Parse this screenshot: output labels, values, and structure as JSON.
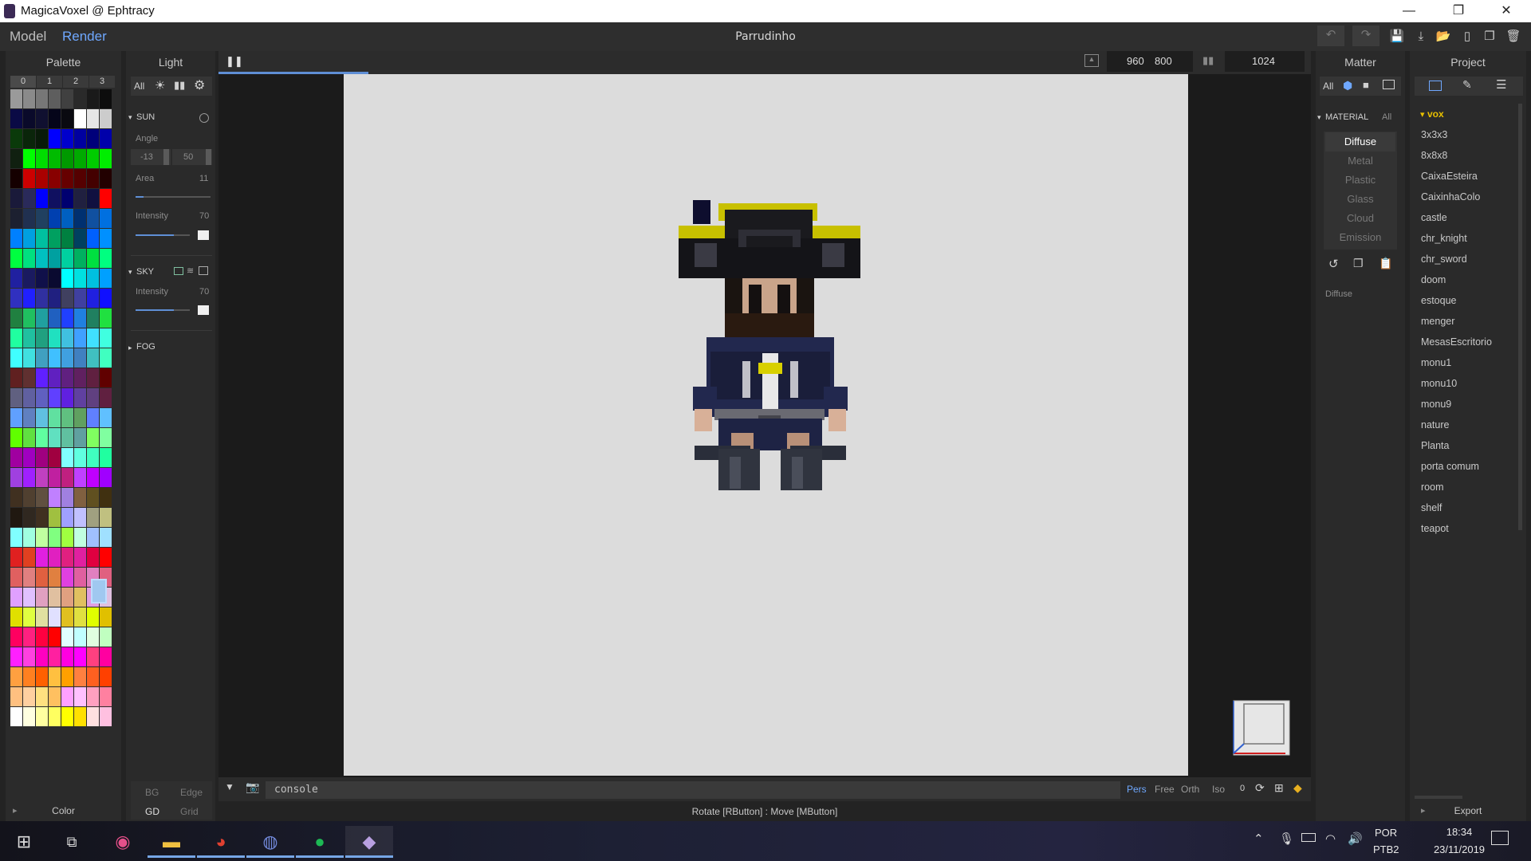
{
  "window": {
    "title": "MagicaVoxel @ Ephtracy",
    "minimize": "—",
    "restore": "❐",
    "close": "✕"
  },
  "appbar": {
    "modes": [
      "Model",
      "Render"
    ],
    "active_mode": "Render",
    "document_name": "Parrudinho"
  },
  "palette": {
    "header": "Palette",
    "tabs": [
      "0",
      "1",
      "2",
      "3"
    ],
    "footer_label": "Color",
    "bg_label": "BG",
    "edge_label": "Edge",
    "gd_label": "GD",
    "grid_label": "Grid",
    "colors": [
      "#9a9a9a",
      "#8a8a8a",
      "#777777",
      "#5e5e5e",
      "#404040",
      "#2a2a2a",
      "#1a1a1a",
      "#0d0d0d",
      "#0a0a45",
      "#0a0a2a",
      "#101030",
      "#05051a",
      "#0a0a10",
      "#ffffff",
      "#e6e6e6",
      "#cccccc",
      "#0a3a0a",
      "#0a250a",
      "#081a08",
      "#0000ff",
      "#0000cc",
      "#0000a0",
      "#00007a",
      "#0000aa",
      "#102010",
      "#00ff00",
      "#00dd00",
      "#00bb00",
      "#009900",
      "#00aa00",
      "#00cc00",
      "#00ee00",
      "#150000",
      "#cc0000",
      "#aa0000",
      "#880000",
      "#660000",
      "#550000",
      "#440000",
      "#220000",
      "#1a1a3a",
      "#2a2a5a",
      "#0000ff",
      "#101060",
      "#000070",
      "#202040",
      "#101040",
      "#ff0000",
      "#1c2030",
      "#203050",
      "#204060",
      "#0040b0",
      "#0060c0",
      "#003070",
      "#1050a0",
      "#0070e0",
      "#0080ff",
      "#00a0e0",
      "#00c0a0",
      "#00a060",
      "#008040",
      "#004060",
      "#0060ff",
      "#0090ff",
      "#00ff40",
      "#00e080",
      "#00c0c0",
      "#00a0a0",
      "#00d0a0",
      "#00b060",
      "#00e040",
      "#00ff80",
      "#2020a0",
      "#1a1a60",
      "#10104a",
      "#0a0a30",
      "#00ffff",
      "#00e0e0",
      "#00c0e0",
      "#00a0ff",
      "#3030c0",
      "#2020ff",
      "#3030a0",
      "#202080",
      "#404060",
      "#4040a0",
      "#2020e0",
      "#1010ff",
      "#208040",
      "#20c060",
      "#20a0a0",
      "#2060c0",
      "#2040ff",
      "#2080e0",
      "#208060",
      "#20e040",
      "#20ffa0",
      "#20c0a0",
      "#20a080",
      "#20e0c0",
      "#40c0e0",
      "#40a0ff",
      "#40e0ff",
      "#40ffe0",
      "#40ffff",
      "#40e0e0",
      "#40a0c0",
      "#40c0ff",
      "#40a0e0",
      "#4080c0",
      "#40c0c0",
      "#40ffc0",
      "#602020",
      "#603030",
      "#6020ff",
      "#6020c0",
      "#602080",
      "#602060",
      "#602040",
      "#600000",
      "#606080",
      "#6060a0",
      "#6060c0",
      "#6040ff",
      "#6020e0",
      "#6040a0",
      "#604080",
      "#602040",
      "#60a0ff",
      "#6080c0",
      "#60c0e0",
      "#60e0a0",
      "#60c080",
      "#60a060",
      "#6080ff",
      "#60c0ff",
      "#60ff00",
      "#60e040",
      "#60ffa0",
      "#60e0c0",
      "#60c0a0",
      "#60a0a0",
      "#80ff60",
      "#80ffa0",
      "#a000a0",
      "#a000c0",
      "#a00080",
      "#a00040",
      "#80ffff",
      "#60ffe0",
      "#40ffc0",
      "#20ffa0",
      "#a040e0",
      "#a020ff",
      "#c040c0",
      "#c020a0",
      "#c02080",
      "#c040ff",
      "#c000ff",
      "#a000ff",
      "#403020",
      "#504030",
      "#605040",
      "#c080ff",
      "#a080e0",
      "#806040",
      "#605020",
      "#403010",
      "#201810",
      "#302820",
      "#403020",
      "#a0c040",
      "#a0a0ff",
      "#c0c0ff",
      "#a0a080",
      "#c0c080",
      "#80ffff",
      "#a0ffe0",
      "#c0ffa0",
      "#80ff80",
      "#a0ff40",
      "#c0ffe0",
      "#a0c0ff",
      "#a0e0ff",
      "#e02020",
      "#e04020",
      "#e020e0",
      "#e020c0",
      "#e02080",
      "#e020a0",
      "#e00040",
      "#ff0000",
      "#e06060",
      "#e08080",
      "#e06040",
      "#e08040",
      "#e040e0",
      "#e060a0",
      "#e080c0",
      "#e06080",
      "#e0a0ff",
      "#e0c0ff",
      "#e0a0c0",
      "#e0c0a0",
      "#e0a080",
      "#e0c060",
      "#e0a0e0",
      "#e0c0e0",
      "#e0e000",
      "#e0ff40",
      "#e0e0a0",
      "#e0e0ff",
      "#e0c020",
      "#e0e040",
      "#e0ff00",
      "#e0c000",
      "#ff0060",
      "#ff2080",
      "#ff0040",
      "#ff0000",
      "#e0ffff",
      "#c0ffff",
      "#e0ffe0",
      "#c0ffc0",
      "#ff20ff",
      "#ff40e0",
      "#ff00c0",
      "#ff20a0",
      "#ff00e0",
      "#ff00ff",
      "#ff4080",
      "#ff00a0",
      "#ffa040",
      "#ff8020",
      "#ff6000",
      "#ffc040",
      "#ffa000",
      "#ff8040",
      "#ff6020",
      "#ff4000",
      "#ffc080",
      "#ffd0a0",
      "#ffe080",
      "#ffc060",
      "#ffa0ff",
      "#ffc0ff",
      "#ffa0c0",
      "#ff80a0",
      "#ffffff",
      "#ffffe0",
      "#ffffa0",
      "#ffff60",
      "#ffff00",
      "#ffe000",
      "#ffe0e0",
      "#ffc0e0"
    ]
  },
  "light": {
    "header": "Light",
    "filter_all": "All",
    "sun": {
      "label": "SUN",
      "angle_label": "Angle",
      "angle_x": "-13",
      "angle_y": "50",
      "area_label": "Area",
      "area_value": "11",
      "area_level": 0.11,
      "intensity_label": "Intensity",
      "intensity_value": "70",
      "intensity_level": 0.7
    },
    "sky": {
      "label": "SKY",
      "intensity_label": "Intensity",
      "intensity_value": "70",
      "intensity_level": 0.7
    },
    "fog": {
      "label": "FOG"
    }
  },
  "viewport": {
    "resolution_w": "960",
    "resolution_h": "800",
    "samples": "1024",
    "progress": 0.25,
    "console_placeholder": "console",
    "camera_modes": [
      "Pers",
      "Free",
      "Orth",
      "Iso"
    ],
    "active_camera": "Pers",
    "camera_index": "0",
    "hint": "Rotate [RButton] : Move [MButton]"
  },
  "matter": {
    "header": "Matter",
    "filter_all": "All",
    "material_label": "MATERIAL",
    "material_all": "All",
    "materials": [
      "Diffuse",
      "Metal",
      "Plastic",
      "Glass",
      "Cloud",
      "Emission"
    ],
    "active_material": "Diffuse",
    "selected_label": "Diffuse"
  },
  "project": {
    "header": "Project",
    "folder": "vox",
    "files": [
      "3x3x3",
      "8x8x8",
      "CaixaEsteira",
      "CaixinhaColo",
      "castle",
      "chr_knight",
      "chr_sword",
      "doom",
      "estoque",
      "menger",
      "MesasEscritorio",
      "monu1",
      "monu10",
      "monu9",
      "nature",
      "Planta",
      "porta comum",
      "room",
      "shelf",
      "teapot"
    ],
    "export_label": "Export"
  },
  "taskbar": {
    "lang_top": "POR",
    "lang_bottom": "PTB2",
    "time": "18:34",
    "date": "23/11/2019"
  },
  "colors": {
    "accent": "#5f8fd6",
    "render_bg": "#dcdcdc",
    "active_mode": "#6fa8ff"
  }
}
